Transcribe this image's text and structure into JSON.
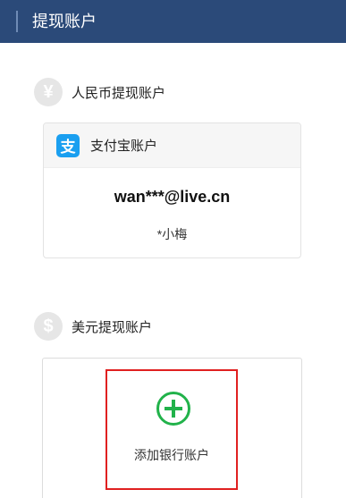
{
  "header": {
    "title": "提现账户"
  },
  "cny_section": {
    "icon": "yen-icon",
    "icon_glyph": "¥",
    "title": "人民币提现账户",
    "card": {
      "provider_icon": "alipay-icon",
      "provider_glyph": "支",
      "provider": "支付宝账户",
      "email": "wan***@live.cn",
      "name": "*小梅"
    }
  },
  "usd_section": {
    "icon": "dollar-icon",
    "icon_glyph": "$",
    "title": "美元提现账户",
    "add_button": {
      "icon": "plus-circle-icon",
      "label": "添加银行账户"
    }
  },
  "colors": {
    "header_bg": "#2b4a79",
    "alipay_blue": "#1a9ff0",
    "add_green": "#21b24a",
    "highlight_red": "#e02020"
  }
}
